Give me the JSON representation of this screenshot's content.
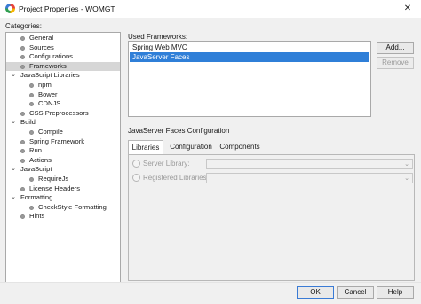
{
  "window": {
    "title": "Project Properties - WOMGT",
    "close_glyph": "✕"
  },
  "categories": {
    "label": "Categories:",
    "items": [
      {
        "label": "General",
        "level": 1,
        "type": "leaf"
      },
      {
        "label": "Sources",
        "level": 1,
        "type": "leaf"
      },
      {
        "label": "Configurations",
        "level": 1,
        "type": "leaf"
      },
      {
        "label": "Frameworks",
        "level": 1,
        "type": "leaf",
        "selected": true
      },
      {
        "label": "JavaScript Libraries",
        "level": 0,
        "type": "expanded"
      },
      {
        "label": "npm",
        "level": 2,
        "type": "leaf"
      },
      {
        "label": "Bower",
        "level": 2,
        "type": "leaf"
      },
      {
        "label": "CDNJS",
        "level": 2,
        "type": "leaf"
      },
      {
        "label": "CSS Preprocessors",
        "level": 1,
        "type": "leaf"
      },
      {
        "label": "Build",
        "level": 0,
        "type": "expanded"
      },
      {
        "label": "Compile",
        "level": 2,
        "type": "leaf"
      },
      {
        "label": "Spring Framework",
        "level": 1,
        "type": "leaf"
      },
      {
        "label": "Run",
        "level": 1,
        "type": "leaf"
      },
      {
        "label": "Actions",
        "level": 1,
        "type": "leaf"
      },
      {
        "label": "JavaScript",
        "level": 0,
        "type": "expanded"
      },
      {
        "label": "RequireJs",
        "level": 2,
        "type": "leaf"
      },
      {
        "label": "License Headers",
        "level": 1,
        "type": "leaf"
      },
      {
        "label": "Formatting",
        "level": 0,
        "type": "expanded"
      },
      {
        "label": "CheckStyle Formatting",
        "level": 2,
        "type": "leaf"
      },
      {
        "label": "Hints",
        "level": 1,
        "type": "leaf"
      }
    ]
  },
  "used_frameworks": {
    "label": "Used Frameworks:",
    "items": [
      {
        "label": "Spring Web MVC",
        "selected": false
      },
      {
        "label": "JavaServer Faces",
        "selected": true
      }
    ],
    "add_label": "Add...",
    "remove_label": "Remove"
  },
  "jsf_config": {
    "title": "JavaServer Faces Configuration",
    "tabs": [
      {
        "label": "Libraries",
        "active": true
      },
      {
        "label": "Configuration",
        "active": false
      },
      {
        "label": "Components",
        "active": false
      }
    ],
    "server_library_label": "Server Library:",
    "registered_libraries_label": "Registered Libraries:",
    "server_library_value": "",
    "registered_libraries_value": ""
  },
  "footer": {
    "ok_label": "OK",
    "cancel_label": "Cancel",
    "help_label": "Help"
  },
  "colors": {
    "selection_blue": "#2f7fd8",
    "tree_selection": "#d6d6d6"
  }
}
